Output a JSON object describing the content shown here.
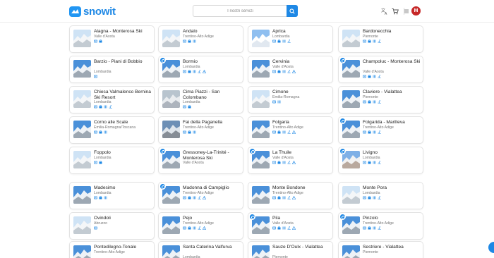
{
  "app": {
    "logo_text": "snowit"
  },
  "header": {
    "search_placeholder": "I nostri servizi",
    "avatar_letter": "M",
    "accent": "#1e88e5"
  },
  "resorts": [
    {
      "name": "Alagna - Monterosa Ski",
      "region": "Valle d'Aosta",
      "badge": false,
      "icons": [
        "pass",
        "shop"
      ],
      "palette": "white"
    },
    {
      "name": "Andalo",
      "region": "Trentino-Alto Adige",
      "badge": false,
      "icons": [
        "pass",
        "shop",
        "rent"
      ],
      "palette": "white"
    },
    {
      "name": "Aprica",
      "region": "Lombardia",
      "badge": false,
      "icons": [
        "pass",
        "shop",
        "rent",
        "ski"
      ],
      "palette": "sun"
    },
    {
      "name": "Bardonecchia",
      "region": "Piemonte",
      "badge": false,
      "icons": [
        "pass",
        "shop",
        "rent",
        "ski"
      ],
      "palette": "white"
    },
    {
      "name": "Barzio - Piani di Bobbio",
      "region": "Lombardia",
      "badge": false,
      "icons": [
        "pass"
      ],
      "palette": "blue"
    },
    {
      "name": "Bormio",
      "region": "Lombardia",
      "badge": true,
      "icons": [
        "pass",
        "shop",
        "rent",
        "ski",
        "warn"
      ],
      "palette": "blue"
    },
    {
      "name": "Cervinia",
      "region": "Valle d'Aosta",
      "badge": false,
      "icons": [
        "pass",
        "shop",
        "rent",
        "ski",
        "warn"
      ],
      "palette": "blue"
    },
    {
      "name": "Champoluc - Monterosa Ski",
      "region": "Valle d'Aosta",
      "badge": true,
      "icons": [
        "pass",
        "shop",
        "rent",
        "ski"
      ],
      "palette": "blue"
    },
    {
      "name": "Chiesa Valmalenco Bernina Ski Resort",
      "region": "Lombardia",
      "badge": false,
      "icons": [
        "pass",
        "shop",
        "rent",
        "ski"
      ],
      "palette": "white"
    },
    {
      "name": "Cima Piazzi - San Colombano",
      "region": "Lombardia",
      "badge": false,
      "icons": [
        "pass",
        "shop"
      ],
      "palette": "grey"
    },
    {
      "name": "Cimone",
      "region": "Emilia-Romagna",
      "badge": false,
      "icons": [
        "pass",
        "rent"
      ],
      "palette": "white"
    },
    {
      "name": "Claviere - Vialattea",
      "region": "Piemonte",
      "badge": false,
      "icons": [
        "pass",
        "shop",
        "rent",
        "ski"
      ],
      "palette": "blue"
    },
    {
      "name": "Corno alle Scale",
      "region": "Emilia-Romagna/Toscana",
      "badge": false,
      "icons": [
        "pass",
        "shop",
        "rent"
      ],
      "palette": "blue"
    },
    {
      "name": "Fai della Paganella",
      "region": "Trentino-Alto Adige",
      "badge": false,
      "icons": [
        "pass",
        "shop",
        "rent"
      ],
      "palette": "dark"
    },
    {
      "name": "Folgaria",
      "region": "Trentino-Alto Adige",
      "badge": false,
      "icons": [
        "pass",
        "shop",
        "rent",
        "ski",
        "warn"
      ],
      "palette": "blue"
    },
    {
      "name": "Folgarida - Marilleva",
      "region": "Trentino-Alto Adige",
      "badge": true,
      "icons": [
        "pass",
        "shop",
        "rent",
        "ski"
      ],
      "palette": "blue"
    },
    {
      "name": "Foppolo",
      "region": "Lombardia",
      "badge": false,
      "icons": [
        "pass",
        "shop"
      ],
      "palette": "white"
    },
    {
      "name": "Gressoney-La-Trinité - Monterosa Ski",
      "region": "Valle d'Aosta",
      "badge": true,
      "icons": [],
      "palette": "blue"
    },
    {
      "name": "La Thuile",
      "region": "Valle d'Aosta",
      "badge": true,
      "icons": [
        "pass",
        "shop",
        "rent",
        "ski",
        "warn"
      ],
      "palette": "blue"
    },
    {
      "name": "Livigno",
      "region": "Lombardia",
      "badge": true,
      "icons": [
        "pass",
        "shop",
        "rent",
        "ski"
      ],
      "palette": "town"
    },
    {
      "name": "Madesimo",
      "region": "Lombardia",
      "badge": false,
      "icons": [
        "pass",
        "shop",
        "rent"
      ],
      "palette": "blue"
    },
    {
      "name": "Madonna di Campiglio",
      "region": "Trentino-Alto Adige",
      "badge": true,
      "icons": [
        "pass",
        "shop",
        "rent",
        "ski",
        "warn"
      ],
      "palette": "blue"
    },
    {
      "name": "Monte Bondone",
      "region": "Trentino-Alto Adige",
      "badge": false,
      "icons": [
        "pass",
        "shop",
        "rent",
        "ski",
        "warn"
      ],
      "palette": "blue"
    },
    {
      "name": "Monte Pora",
      "region": "Lombardia",
      "badge": false,
      "icons": [
        "pass",
        "shop",
        "rent",
        "ski"
      ],
      "palette": "white"
    },
    {
      "name": "Ovindoli",
      "region": "Abruzzo",
      "badge": false,
      "icons": [
        "pass"
      ],
      "palette": "white"
    },
    {
      "name": "Pejo",
      "region": "Trentino-Alto Adige",
      "badge": false,
      "icons": [
        "pass",
        "shop",
        "rent",
        "ski",
        "warn"
      ],
      "palette": "blue"
    },
    {
      "name": "Pila",
      "region": "Valle d'Aosta",
      "badge": true,
      "icons": [
        "pass",
        "shop",
        "rent",
        "ski",
        "warn"
      ],
      "palette": "blue"
    },
    {
      "name": "Pinzolo",
      "region": "Trentino-Alto Adige",
      "badge": true,
      "icons": [
        "pass",
        "shop",
        "rent",
        "ski"
      ],
      "palette": "blue"
    },
    {
      "name": "Pontedilegno-Tonale",
      "region": "Trentino-Alto Adige",
      "badge": false,
      "icons": [],
      "palette": "blue"
    },
    {
      "name": "Santa Caterina Valfurva",
      "region": "Lombardia",
      "badge": false,
      "icons": [],
      "palette": "blue"
    },
    {
      "name": "Sauze D'Oulx - Vialattea",
      "region": "Piemonte",
      "badge": false,
      "icons": [],
      "palette": "blue"
    },
    {
      "name": "Sestriere - Vialattea",
      "region": "Piemonte",
      "badge": false,
      "icons": [],
      "palette": "blue"
    }
  ]
}
